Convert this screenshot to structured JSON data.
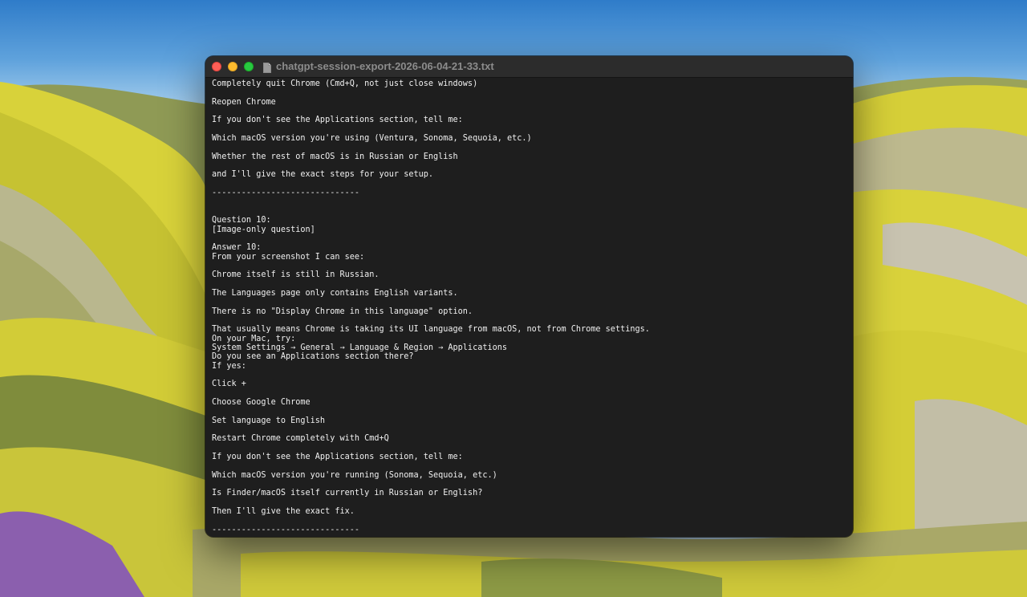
{
  "desktop": {
    "wallpaper": "yellow-flower-hills"
  },
  "window": {
    "title": "chatgpt-session-export-2026-06-04-21-33.txt",
    "title_icon": "document-icon",
    "controls": {
      "close_color": "#fe5f57",
      "minimize_color": "#febc2e",
      "maximize_color": "#28c840"
    },
    "lines": [
      "Completely quit Chrome (Cmd+Q, not just close windows)",
      "",
      "Reopen Chrome",
      "",
      "If you don't see the Applications section, tell me:",
      "",
      "Which macOS version you're using (Ventura, Sonoma, Sequoia, etc.)",
      "",
      "Whether the rest of macOS is in Russian or English",
      "",
      "and I'll give the exact steps for your setup.",
      "",
      "------------------------------",
      "",
      "",
      "Question 10:",
      "[Image-only question]",
      "",
      "Answer 10:",
      "From your screenshot I can see:",
      "",
      "Chrome itself is still in Russian.",
      "",
      "The Languages page only contains English variants.",
      "",
      "There is no \"Display Chrome in this language\" option.",
      "",
      "That usually means Chrome is taking its UI language from macOS, not from Chrome settings.",
      "On your Mac, try:",
      "System Settings → General → Language & Region → Applications",
      "Do you see an Applications section there?",
      "If yes:",
      "",
      "Click +",
      "",
      "Choose Google Chrome",
      "",
      "Set language to English",
      "",
      "Restart Chrome completely with Cmd+Q",
      "",
      "If you don't see the Applications section, tell me:",
      "",
      "Which macOS version you're running (Sonoma, Sequoia, etc.)",
      "",
      "Is Finder/macOS itself currently in Russian or English?",
      "",
      "Then I'll give the exact fix.",
      "",
      "------------------------------"
    ]
  }
}
